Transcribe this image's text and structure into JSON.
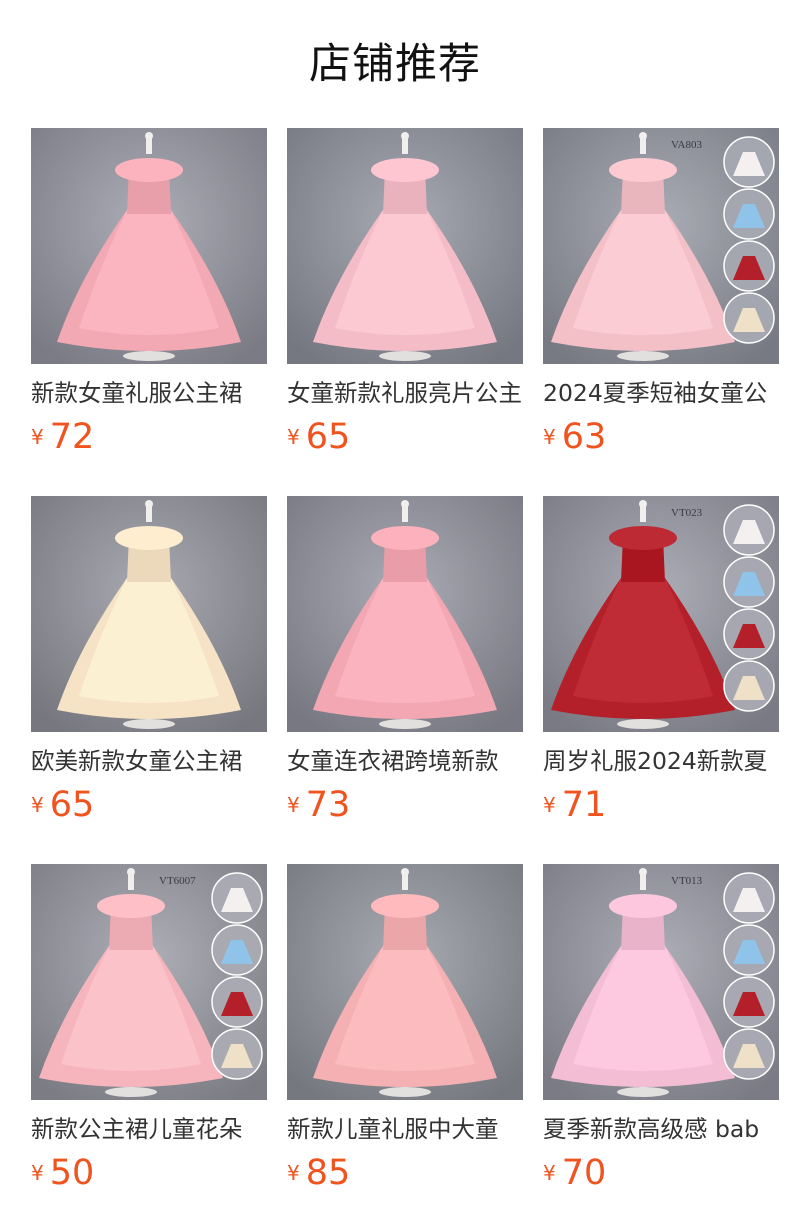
{
  "header": {
    "title": "店铺推荐"
  },
  "products": [
    {
      "name": "新款女童礼服公主裙",
      "currency": "¥",
      "price": "72",
      "dress_color": "#f2a9b4",
      "bg_color": "#8e8f98"
    },
    {
      "name": "女童新款礼服亮片公主",
      "currency": "¥",
      "price": "65",
      "dress_color": "#f4bcc6",
      "bg_color": "#898b95"
    },
    {
      "name": "2024夏季短袖女童公",
      "currency": "¥",
      "price": "63",
      "dress_color": "#f3c0c8",
      "bg_color": "#8c8e97",
      "code": "VA803"
    },
    {
      "name": "欧美新款女童公主裙",
      "currency": "¥",
      "price": "65",
      "dress_color": "#f6e3c6",
      "bg_color": "#8a8b93"
    },
    {
      "name": "女童连衣裙跨境新款",
      "currency": "¥",
      "price": "73",
      "dress_color": "#f2a7b3",
      "bg_color": "#8b8c95"
    },
    {
      "name": "周岁礼服2024新款夏",
      "currency": "¥",
      "price": "71",
      "dress_color": "#b3202a",
      "bg_color": "#8d8e97",
      "code": "VT023"
    },
    {
      "name": "新款公主裙儿童花朵",
      "currency": "¥",
      "price": "50",
      "dress_color": "#f6b5bc",
      "bg_color": "#8f9098",
      "code": "VT6007"
    },
    {
      "name": "新款儿童礼服中大童",
      "currency": "¥",
      "price": "85",
      "dress_color": "#f4b0b2",
      "bg_color": "#8a8c94"
    },
    {
      "name": "夏季新款高级感 bab",
      "currency": "¥",
      "price": "70",
      "dress_color": "#f3bdd3",
      "bg_color": "#8e8f98",
      "code": "VT013"
    }
  ]
}
